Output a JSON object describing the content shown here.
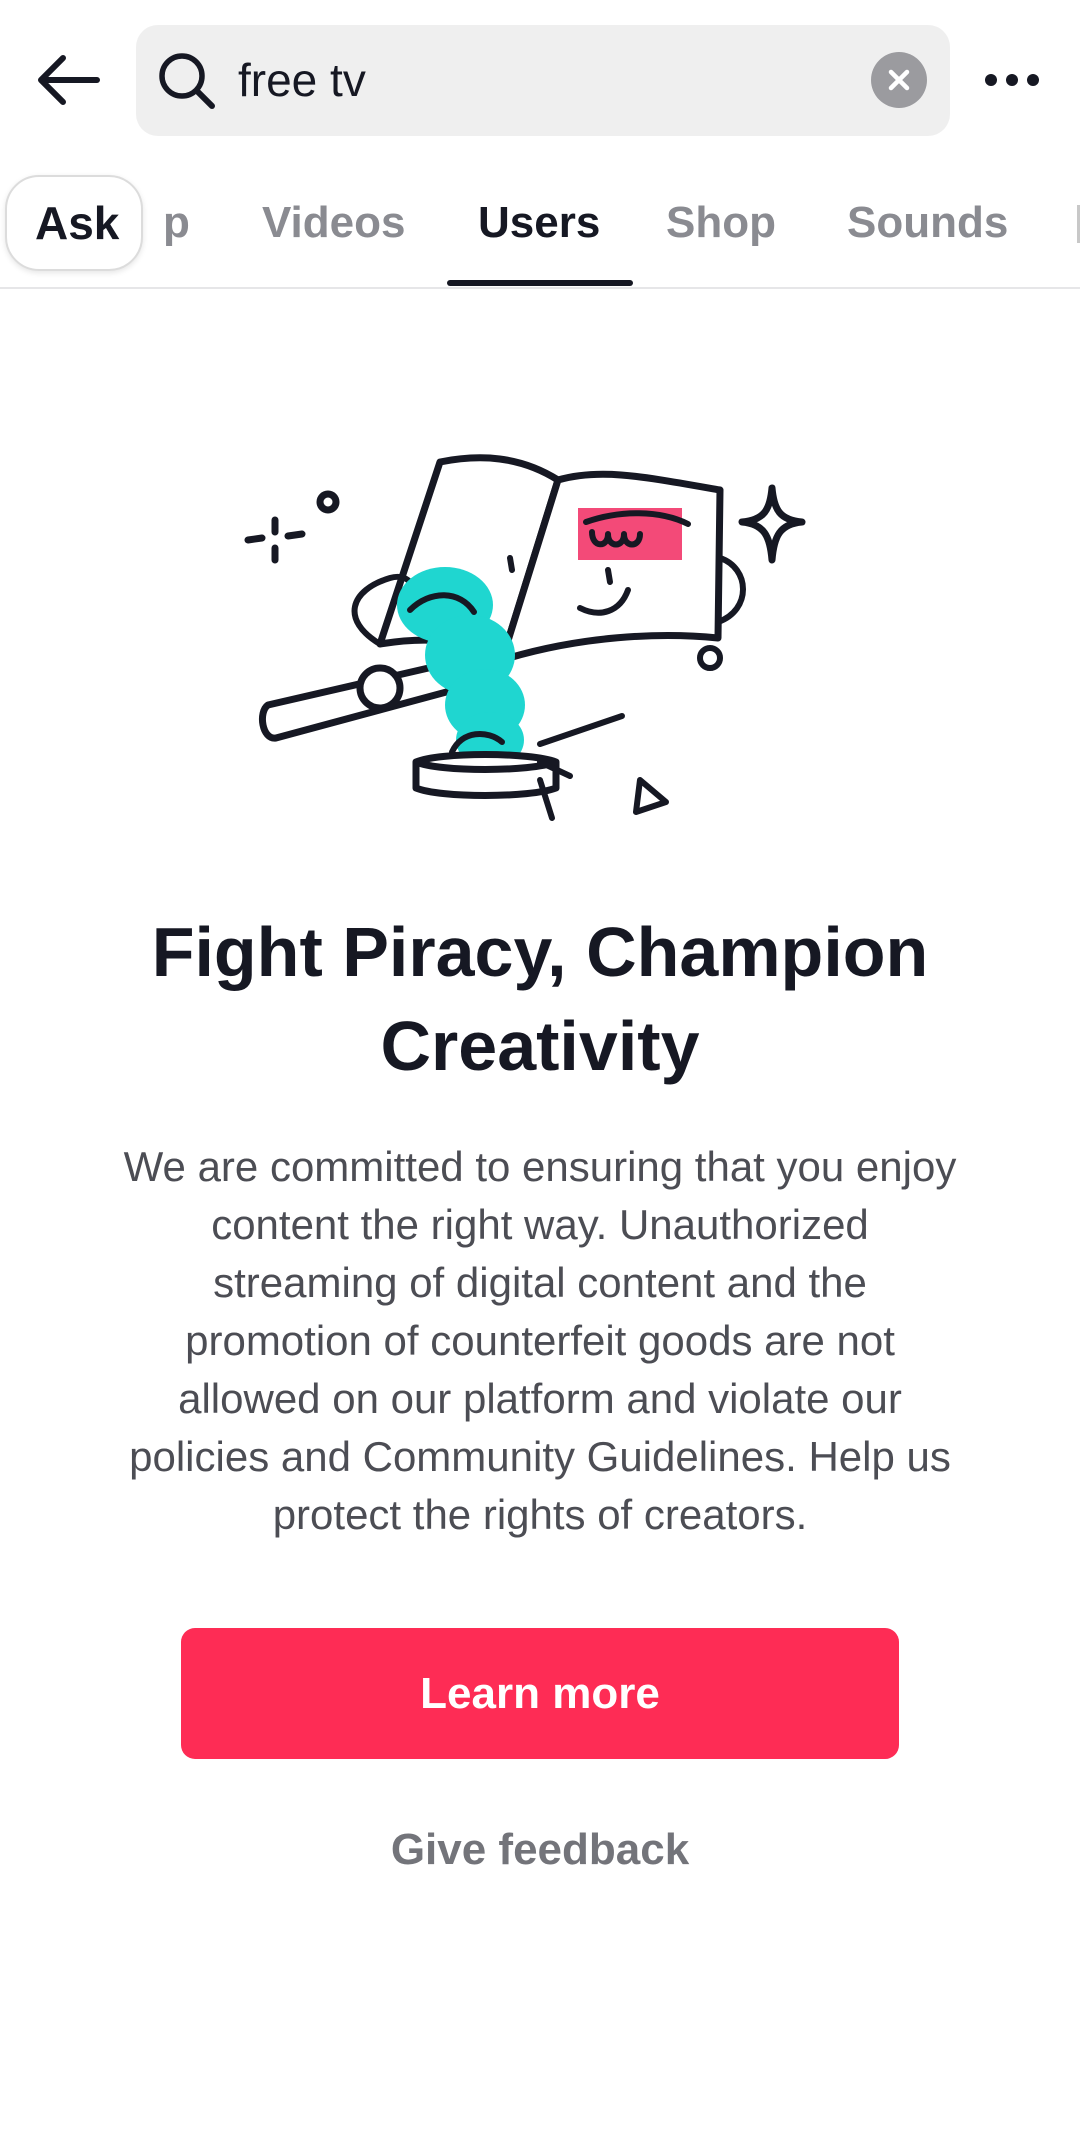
{
  "header": {
    "back_icon": "arrow-left-icon",
    "search": {
      "value": "free tv",
      "icon": "search-icon",
      "clear_icon": "close-circle-icon"
    },
    "more_icon": "more-horizontal-icon"
  },
  "tabs": {
    "ask_label": "Ask",
    "items": [
      {
        "label": "p"
      },
      {
        "label": "Videos"
      },
      {
        "label": "Users"
      },
      {
        "label": "Shop"
      },
      {
        "label": "Sounds"
      }
    ],
    "active": "Users"
  },
  "notice": {
    "illustration": "book-gavel-illustration",
    "title_line1": "Fight Piracy, Champion",
    "title_line2": "Creativity",
    "body_lines": [
      "We are committed to ensuring that you enjoy",
      "content the right way. Unauthorized",
      "streaming of digital content and the",
      "promotion of counterfeit goods are not",
      "allowed on our platform and violate our",
      "policies and Community Guidelines. Help us",
      "protect the rights of creators."
    ],
    "learn_more_label": "Learn more",
    "feedback_label": "Give feedback"
  },
  "colors": {
    "accent": "#fe2c55",
    "illustration_teal": "#1fd6d0",
    "illustration_pink": "#f34a78",
    "text_primary": "#161823",
    "text_secondary": "#4c4d54",
    "tab_inactive": "#8a8b91",
    "search_bg": "#efefef"
  }
}
